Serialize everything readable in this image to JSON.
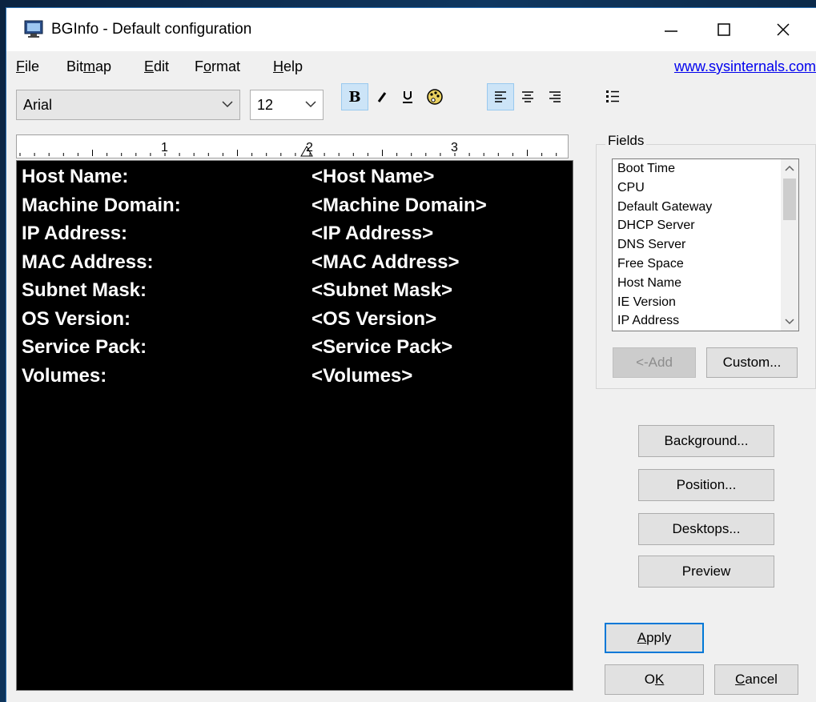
{
  "window": {
    "title": "BGInfo - Default configuration"
  },
  "menu": {
    "items": [
      {
        "pre": "",
        "acc": "F",
        "post": "ile"
      },
      {
        "pre": "Bit",
        "acc": "m",
        "post": "ap"
      },
      {
        "pre": "",
        "acc": "E",
        "post": "dit"
      },
      {
        "pre": "F",
        "acc": "o",
        "post": "rmat"
      },
      {
        "pre": "",
        "acc": "H",
        "post": "elp"
      }
    ],
    "link": "www.sysinternals.com"
  },
  "toolbar": {
    "font": "Arial",
    "size": "12",
    "bold_active": true,
    "align_left_active": true
  },
  "ruler": {
    "marks": [
      "1",
      "2",
      "3"
    ]
  },
  "editor": {
    "rows": [
      {
        "label": "Host Name:",
        "field": "<Host Name>"
      },
      {
        "label": "Machine Domain:",
        "field": "<Machine Domain>"
      },
      {
        "label": "IP Address:",
        "field": "<IP Address>"
      },
      {
        "label": "MAC Address:",
        "field": "<MAC Address>"
      },
      {
        "label": "Subnet Mask:",
        "field": "<Subnet Mask>"
      },
      {
        "label": "OS Version:",
        "field": "<OS Version>"
      },
      {
        "label": "Service Pack:",
        "field": "<Service Pack>"
      },
      {
        "label": "Volumes:",
        "field": "<Volumes>"
      }
    ]
  },
  "fields": {
    "legend": "Fields",
    "items": [
      "Boot Time",
      "CPU",
      "Default Gateway",
      "DHCP Server",
      "DNS Server",
      "Free Space",
      "Host Name",
      "IE Version",
      "IP Address"
    ],
    "add_label": "<-Add",
    "custom_label": "Custom..."
  },
  "buttons": {
    "background": "Background...",
    "position": "Position...",
    "desktops": "Desktops...",
    "preview": "Preview",
    "apply": {
      "acc": "A",
      "post": "pply"
    },
    "ok": {
      "pre": "O",
      "acc": "K"
    },
    "cancel": {
      "acc": "C",
      "post": "ancel"
    }
  }
}
